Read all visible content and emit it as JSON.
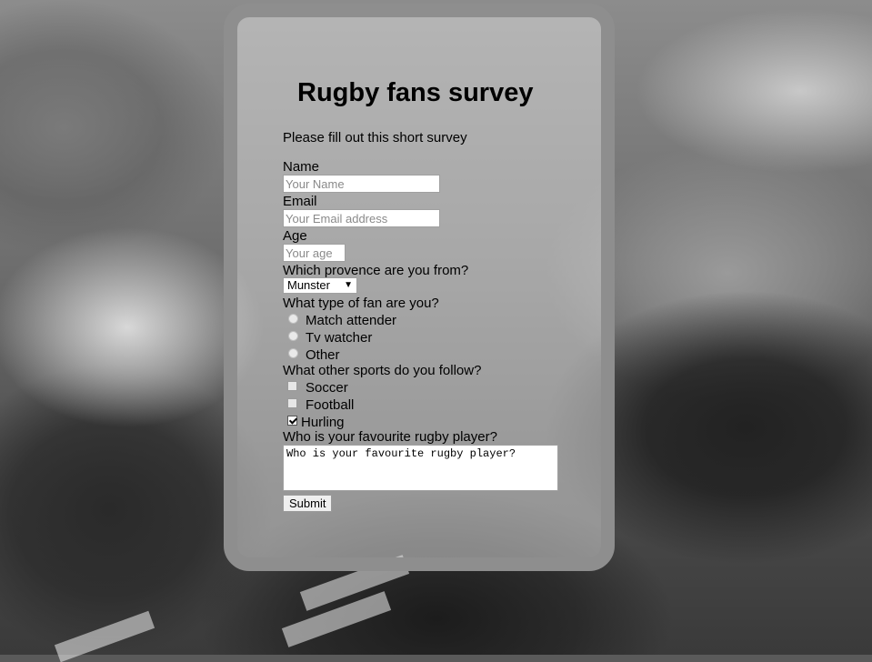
{
  "survey": {
    "title": "Rugby fans survey",
    "intro": "Please fill out this short survey",
    "name": {
      "label": "Name",
      "placeholder": "Your Name"
    },
    "email": {
      "label": "Email",
      "placeholder": "Your Email address"
    },
    "age": {
      "label": "Age",
      "placeholder": "Your age"
    },
    "province": {
      "label": "Which provence are you from?",
      "selected": "Munster"
    },
    "fan_type": {
      "label": "What type of fan are you?",
      "options": [
        "Match attender",
        "Tv watcher",
        "Other"
      ]
    },
    "sports": {
      "label": "What other sports do you follow?",
      "options": [
        "Soccer",
        "Football",
        "Hurling"
      ],
      "checked": [
        "Hurling"
      ]
    },
    "favourite": {
      "label": "Who is your favourite rugby player?",
      "placeholder": "Who is your favourite rugby player?"
    },
    "submit_label": "Submit"
  },
  "colors": {
    "panel_border": "#8e8e8e",
    "panel_bg": "#d7d7d7"
  }
}
